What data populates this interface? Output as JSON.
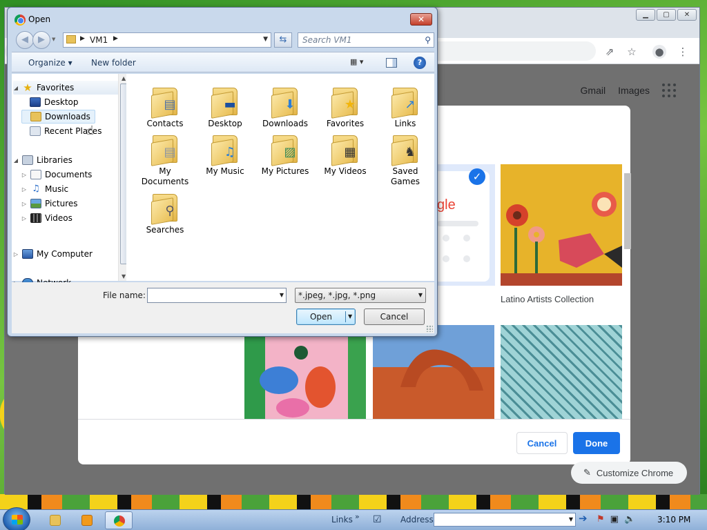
{
  "dialog": {
    "title": "Open",
    "address": {
      "crumb": "VM1"
    },
    "search_placeholder": "Search VM1",
    "toolbar": {
      "organize": "Organize ▾",
      "new_folder": "New folder"
    },
    "nav_tree": {
      "favorites": "Favorites",
      "desktop": "Desktop",
      "downloads": "Downloads",
      "recent_places": "Recent Places",
      "libraries": "Libraries",
      "documents": "Documents",
      "music": "Music",
      "pictures": "Pictures",
      "videos": "Videos",
      "my_computer": "My Computer",
      "network": "Network"
    },
    "files": [
      {
        "label": "Contacts",
        "icon": "contacts-icon"
      },
      {
        "label": "Desktop",
        "icon": "desktop-icon"
      },
      {
        "label": "Downloads",
        "icon": "download-arrow-icon"
      },
      {
        "label": "Favorites",
        "icon": "star-icon"
      },
      {
        "label": "Links",
        "icon": "link-arrow-icon"
      },
      {
        "label": "My Documents",
        "icon": "documents-icon"
      },
      {
        "label": "My Music",
        "icon": "music-note-icon"
      },
      {
        "label": "My Pictures",
        "icon": "picture-icon"
      },
      {
        "label": "My Videos",
        "icon": "film-icon"
      },
      {
        "label": "Saved Games",
        "icon": "chess-icon"
      },
      {
        "label": "Searches",
        "icon": "magnifier-icon"
      }
    ],
    "file_name_label": "File name:",
    "file_name_value": "",
    "file_type": "*.jpeg, *.jpg, *.png",
    "open_button": "Open",
    "cancel_button": "Cancel"
  },
  "chrome": {
    "header_links": {
      "gmail": "Gmail",
      "images": "Images"
    },
    "customize_modal": {
      "tile_label": "Latino Artists Collection",
      "cancel": "Cancel",
      "done": "Done"
    },
    "customize_chrome": "Customize Chrome"
  },
  "taskbar": {
    "links": "Links",
    "address_label": "Address",
    "address_value": "",
    "clock": "3:10 PM"
  }
}
